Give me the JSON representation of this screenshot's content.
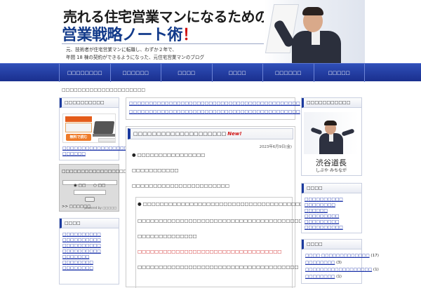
{
  "header": {
    "title_line1": "売れる住宅営業マンになるための",
    "title_line2": "営業戦略ノート術",
    "title_excl": "！",
    "tagline1": "元、技術者が住宅営業マンに転職し、わずか２年で、",
    "tagline2": "年間 18 棟の契約ができるようになった、元住宅営業マンのブログ"
  },
  "nav": {
    "items": [
      "□□□□□□□□",
      "□□□□□□",
      "□□□□",
      "□□□□",
      "□□□□□□",
      "□□□□□"
    ]
  },
  "breadcrumb": "□□□□□□□□□□□□□□□□□□□□□",
  "left_sidebar": {
    "box1_title": "□□□□□□□□□□",
    "banner_text": "無料で読む",
    "box1_links": [
      "□□□□□□□□□□□□□□□□□□□□",
      "□□□□□□"
    ],
    "login": {
      "title": "□□□□□□□□□□□□□□□□□□□□□□□□□□□□□□□□",
      "radio1": "□□",
      "radio2": "□□",
      "footer": ">>  □□□□□□",
      "powered": "powered by □□□□□"
    },
    "box2_title": "□□□□",
    "box2_links": [
      "□□□□□□□□□□",
      "□□□□□□□□□□",
      "□□□□□□□□□□",
      "□□□□□□□□□□",
      "□□□□□□□",
      "□□□□□□□□",
      "□□□□□□□□"
    ]
  },
  "center": {
    "top_links": [
      "□□□□□□□□□□□□□□□□□□□□□□□□□□□□□□□□□□□□□□□□□□□",
      "□□□□□□□□□□□□□□□□□□□□□□□□□□□□□□□□□□□□□□□□□□□"
    ],
    "post_title": "□□□□□□□□□□□□□□□□□□□□",
    "post_badge": "New!",
    "date": "2023年6月9日(金)",
    "bullet_line": "●  □□□□□□□□□□□□□□□□",
    "p1": "□□□□□□□□□□□",
    "p2": "□□□□□□□□□□□□□□□□□□□□□□□",
    "quote_bullet": "●  □□□□□□□□□□□□□□□□□□□□□□□□□□□□□□□□□□□□□□□□□",
    "quote_p1": "□□□□□□□□□□□□□□□□□□□□□□□□□□□□□□□□□□□□□□□□□□□□□□□□□□□",
    "quote_p2": "□□□□□□□□□□□□□□",
    "quote_red": "□□□□□□□□□□□□□□□□□□□□□□□□□□□□□□□□□□",
    "quote_p3": "□□□□□□□□□□□□□□□□□□□□□□□□□□□□□□□□□□□□□□"
  },
  "right_sidebar": {
    "profile_title": "□□□□□□□□□□□",
    "name": "渋谷道長",
    "kana": "しぶや みちなが",
    "box2_title": "□□□□",
    "box2_links": [
      "□□□□□□□□□□",
      "□□□□□□□□",
      "□□□□□□",
      "□□□□□□□□□",
      "□□□□□□□□□",
      "□□□□□□□□□□"
    ],
    "box3_title": "□□□□",
    "categories": [
      {
        "label": "□□□□ □□□□□□□□□□□□□",
        "count": "(17)"
      },
      {
        "label": "□□□□□□□□",
        "count": "(3)"
      },
      {
        "label": "□□□□□□□□□□□□□□□□□□",
        "count": "(1)"
      },
      {
        "label": "□□□□□□□□",
        "count": "(1)"
      }
    ]
  }
}
